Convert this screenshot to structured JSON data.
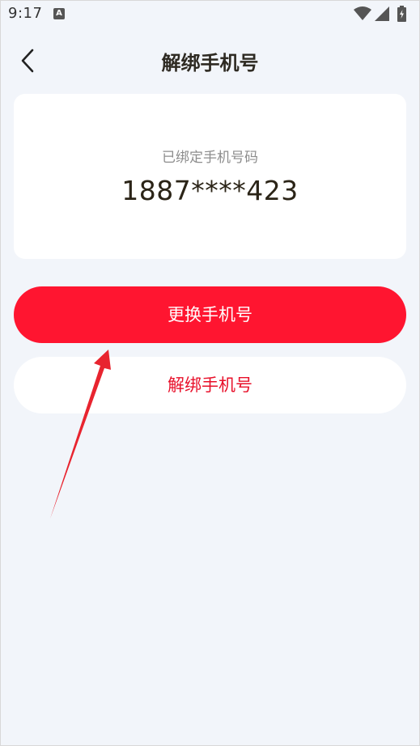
{
  "status_bar": {
    "time": "9:17",
    "notification_icon": "A"
  },
  "header": {
    "title": "解绑手机号",
    "back_icon": "chevron-left-icon"
  },
  "phone_card": {
    "label": "已绑定手机号码",
    "number": "1887****423"
  },
  "buttons": {
    "change_label": "更换手机号",
    "unbind_label": "解绑手机号"
  },
  "colors": {
    "primary_red": "#ff1530",
    "unbind_text": "#e8102a",
    "background": "#f2f5fa",
    "arrow": "#e8242f"
  }
}
